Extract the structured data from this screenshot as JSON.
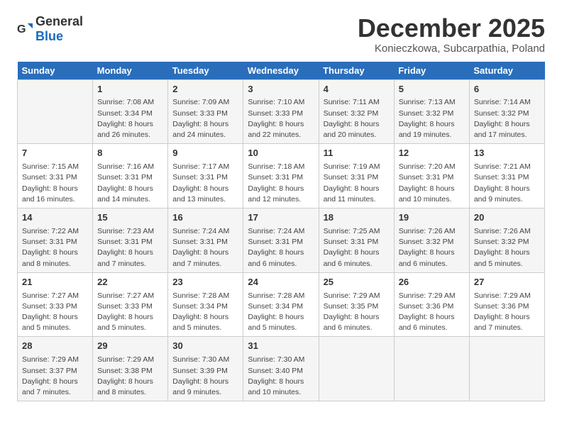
{
  "header": {
    "logo_general": "General",
    "logo_blue": "Blue",
    "title": "December 2025",
    "subtitle": "Konieczkowa, Subcarpathia, Poland"
  },
  "days_of_week": [
    "Sunday",
    "Monday",
    "Tuesday",
    "Wednesday",
    "Thursday",
    "Friday",
    "Saturday"
  ],
  "weeks": [
    [
      {
        "day": "",
        "text": ""
      },
      {
        "day": "1",
        "text": "Sunrise: 7:08 AM\nSunset: 3:34 PM\nDaylight: 8 hours\nand 26 minutes."
      },
      {
        "day": "2",
        "text": "Sunrise: 7:09 AM\nSunset: 3:33 PM\nDaylight: 8 hours\nand 24 minutes."
      },
      {
        "day": "3",
        "text": "Sunrise: 7:10 AM\nSunset: 3:33 PM\nDaylight: 8 hours\nand 22 minutes."
      },
      {
        "day": "4",
        "text": "Sunrise: 7:11 AM\nSunset: 3:32 PM\nDaylight: 8 hours\nand 20 minutes."
      },
      {
        "day": "5",
        "text": "Sunrise: 7:13 AM\nSunset: 3:32 PM\nDaylight: 8 hours\nand 19 minutes."
      },
      {
        "day": "6",
        "text": "Sunrise: 7:14 AM\nSunset: 3:32 PM\nDaylight: 8 hours\nand 17 minutes."
      }
    ],
    [
      {
        "day": "7",
        "text": "Sunrise: 7:15 AM\nSunset: 3:31 PM\nDaylight: 8 hours\nand 16 minutes."
      },
      {
        "day": "8",
        "text": "Sunrise: 7:16 AM\nSunset: 3:31 PM\nDaylight: 8 hours\nand 14 minutes."
      },
      {
        "day": "9",
        "text": "Sunrise: 7:17 AM\nSunset: 3:31 PM\nDaylight: 8 hours\nand 13 minutes."
      },
      {
        "day": "10",
        "text": "Sunrise: 7:18 AM\nSunset: 3:31 PM\nDaylight: 8 hours\nand 12 minutes."
      },
      {
        "day": "11",
        "text": "Sunrise: 7:19 AM\nSunset: 3:31 PM\nDaylight: 8 hours\nand 11 minutes."
      },
      {
        "day": "12",
        "text": "Sunrise: 7:20 AM\nSunset: 3:31 PM\nDaylight: 8 hours\nand 10 minutes."
      },
      {
        "day": "13",
        "text": "Sunrise: 7:21 AM\nSunset: 3:31 PM\nDaylight: 8 hours\nand 9 minutes."
      }
    ],
    [
      {
        "day": "14",
        "text": "Sunrise: 7:22 AM\nSunset: 3:31 PM\nDaylight: 8 hours\nand 8 minutes."
      },
      {
        "day": "15",
        "text": "Sunrise: 7:23 AM\nSunset: 3:31 PM\nDaylight: 8 hours\nand 7 minutes."
      },
      {
        "day": "16",
        "text": "Sunrise: 7:24 AM\nSunset: 3:31 PM\nDaylight: 8 hours\nand 7 minutes."
      },
      {
        "day": "17",
        "text": "Sunrise: 7:24 AM\nSunset: 3:31 PM\nDaylight: 8 hours\nand 6 minutes."
      },
      {
        "day": "18",
        "text": "Sunrise: 7:25 AM\nSunset: 3:31 PM\nDaylight: 8 hours\nand 6 minutes."
      },
      {
        "day": "19",
        "text": "Sunrise: 7:26 AM\nSunset: 3:32 PM\nDaylight: 8 hours\nand 6 minutes."
      },
      {
        "day": "20",
        "text": "Sunrise: 7:26 AM\nSunset: 3:32 PM\nDaylight: 8 hours\nand 5 minutes."
      }
    ],
    [
      {
        "day": "21",
        "text": "Sunrise: 7:27 AM\nSunset: 3:33 PM\nDaylight: 8 hours\nand 5 minutes."
      },
      {
        "day": "22",
        "text": "Sunrise: 7:27 AM\nSunset: 3:33 PM\nDaylight: 8 hours\nand 5 minutes."
      },
      {
        "day": "23",
        "text": "Sunrise: 7:28 AM\nSunset: 3:34 PM\nDaylight: 8 hours\nand 5 minutes."
      },
      {
        "day": "24",
        "text": "Sunrise: 7:28 AM\nSunset: 3:34 PM\nDaylight: 8 hours\nand 5 minutes."
      },
      {
        "day": "25",
        "text": "Sunrise: 7:29 AM\nSunset: 3:35 PM\nDaylight: 8 hours\nand 6 minutes."
      },
      {
        "day": "26",
        "text": "Sunrise: 7:29 AM\nSunset: 3:36 PM\nDaylight: 8 hours\nand 6 minutes."
      },
      {
        "day": "27",
        "text": "Sunrise: 7:29 AM\nSunset: 3:36 PM\nDaylight: 8 hours\nand 7 minutes."
      }
    ],
    [
      {
        "day": "28",
        "text": "Sunrise: 7:29 AM\nSunset: 3:37 PM\nDaylight: 8 hours\nand 7 minutes."
      },
      {
        "day": "29",
        "text": "Sunrise: 7:29 AM\nSunset: 3:38 PM\nDaylight: 8 hours\nand 8 minutes."
      },
      {
        "day": "30",
        "text": "Sunrise: 7:30 AM\nSunset: 3:39 PM\nDaylight: 8 hours\nand 9 minutes."
      },
      {
        "day": "31",
        "text": "Sunrise: 7:30 AM\nSunset: 3:40 PM\nDaylight: 8 hours\nand 10 minutes."
      },
      {
        "day": "",
        "text": ""
      },
      {
        "day": "",
        "text": ""
      },
      {
        "day": "",
        "text": ""
      }
    ]
  ]
}
